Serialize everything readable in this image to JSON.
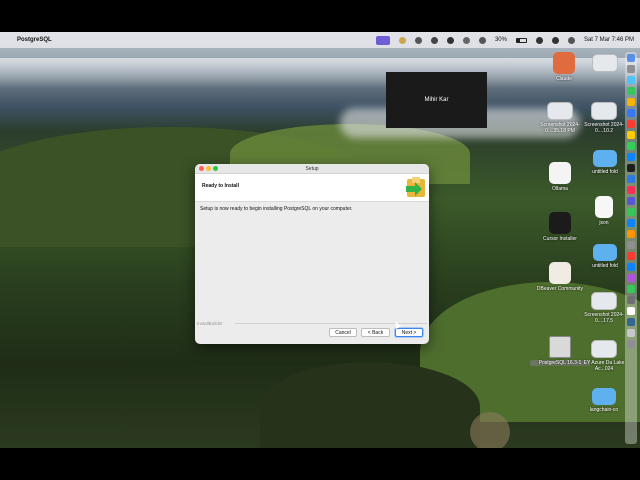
{
  "menubar": {
    "apple": "",
    "app_name": "PostgreSQL",
    "battery_percent": "30%",
    "date_time": "Sat 7 Mar  7:46 PM"
  },
  "video_overlay": {
    "name": "Mihir Kar"
  },
  "desktop_icons": [
    {
      "label": "Claude"
    },
    {
      "label": "Screenshot 2024-0....35.18 PM"
    },
    {
      "label": "Screenshot 2024-0....10.2"
    },
    {
      "label": "Ollama"
    },
    {
      "label": "untitled fold"
    },
    {
      "label": "Cursor Installer"
    },
    {
      "label": "json"
    },
    {
      "label": "DBeaver Community"
    },
    {
      "label": "untitled fold"
    },
    {
      "label": "Screenshot 2024-0....17.5"
    },
    {
      "label": "PostgreSQL 16.3-1"
    },
    {
      "label": "EY Azure Da Lake Ac...024"
    },
    {
      "label": "langchain-co"
    }
  ],
  "installer": {
    "window_title": "Setup",
    "header_title": "Ready to Install",
    "body_text": "Setup is now ready to begin installing PostgreSQL on your computer.",
    "brand": "InstallBuilder",
    "cancel_label": "Cancel",
    "back_label": "< Back",
    "next_label": "Next >"
  },
  "colors": {
    "next_button_border": "#3b84e8",
    "traffic_close": "#ff5f57",
    "traffic_min": "#febc2e",
    "traffic_max": "#28c840",
    "accent_menubar": "#6c5fd6"
  }
}
